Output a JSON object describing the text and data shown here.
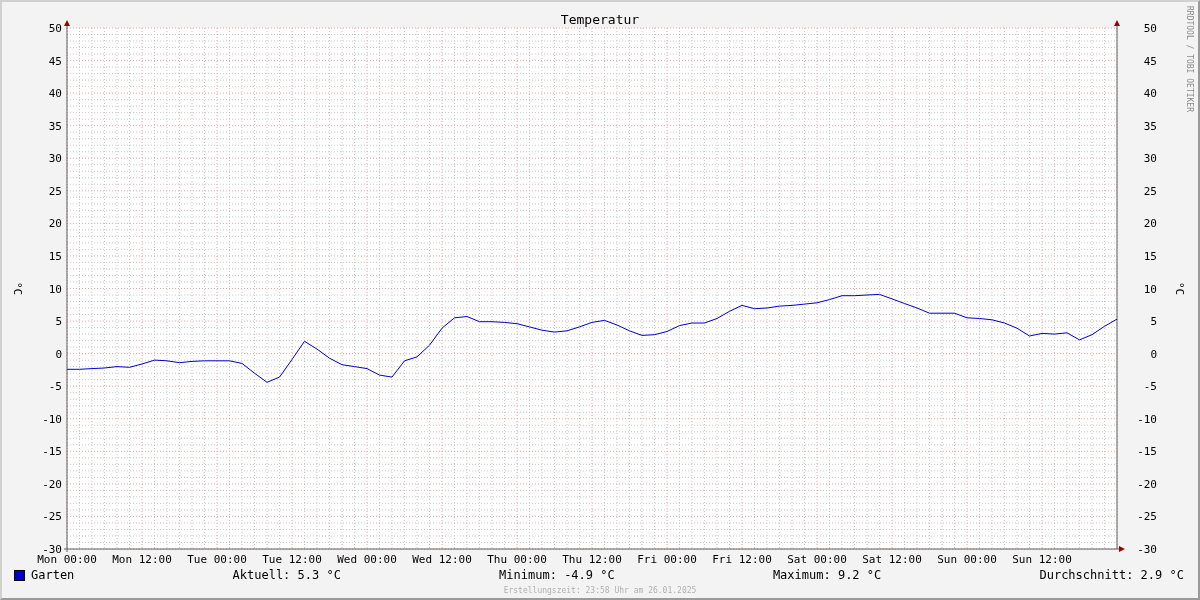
{
  "chart_data": {
    "type": "line",
    "grid": true,
    "title": "Temperatur",
    "ylabel": "°C",
    "ylim": [
      -30,
      50
    ],
    "yticks": [
      50,
      45,
      40,
      35,
      30,
      25,
      20,
      15,
      10,
      5,
      0,
      -5,
      -10,
      -15,
      -20,
      -25,
      -30
    ],
    "categories": [
      "Mon 00:00",
      null,
      null,
      null,
      null,
      null,
      "Mon 12:00",
      null,
      null,
      null,
      null,
      null,
      "Tue 00:00",
      null,
      null,
      null,
      null,
      null,
      "Tue 12:00",
      null,
      null,
      null,
      null,
      null,
      "Wed 00:00",
      null,
      null,
      null,
      null,
      null,
      "Wed 12:00",
      null,
      null,
      null,
      null,
      null,
      "Thu 00:00",
      null,
      null,
      null,
      null,
      null,
      "Thu 12:00",
      null,
      null,
      null,
      null,
      null,
      "Fri 00:00",
      null,
      null,
      null,
      null,
      null,
      "Fri 12:00",
      null,
      null,
      null,
      null,
      null,
      "Sat 00:00",
      null,
      null,
      null,
      null,
      null,
      "Sat 12:00",
      null,
      null,
      null,
      null,
      null,
      "Sun 00:00",
      null,
      null,
      null,
      null,
      null,
      "Sun 12:00",
      null,
      null,
      null,
      null,
      null,
      null
    ],
    "series": [
      {
        "name": "Garten",
        "color": "#0000cc",
        "values": [
          -2.4,
          -2.4,
          -2.3,
          -2.2,
          -2.0,
          -2.1,
          -1.6,
          -1.0,
          -1.1,
          -1.4,
          -1.2,
          -1.1,
          -1.1,
          -1.1,
          -1.5,
          -3.0,
          -4.4,
          -3.6,
          -0.9,
          1.9,
          0.7,
          -0.7,
          -1.7,
          -2.0,
          -2.3,
          -3.3,
          -3.6,
          -1.1,
          -0.5,
          1.3,
          3.9,
          5.5,
          5.7,
          4.9,
          4.9,
          4.8,
          4.6,
          4.1,
          3.6,
          3.3,
          3.5,
          4.1,
          4.8,
          5.1,
          4.4,
          3.5,
          2.8,
          2.9,
          3.4,
          4.3,
          4.7,
          4.7,
          5.4,
          6.5,
          7.4,
          6.9,
          7.0,
          7.3,
          7.4,
          7.6,
          7.8,
          8.3,
          8.9,
          8.9,
          9.0,
          9.1,
          8.4,
          7.7,
          7.0,
          6.2,
          6.2,
          6.2,
          5.5,
          5.4,
          5.2,
          4.7,
          3.9,
          2.7,
          3.1,
          3.0,
          3.2,
          2.1,
          2.9,
          4.2,
          5.3
        ]
      }
    ]
  },
  "right_axis": {
    "label": "°C",
    "ticks": [
      "50",
      "45",
      "40",
      "35",
      "30",
      "25",
      "20",
      "15",
      "10",
      "5",
      "0",
      "-5",
      "-10",
      "-15",
      "-20",
      "-25",
      "-30"
    ]
  },
  "credit": "RRDTOOL / TOBI OETIKER",
  "legend": {
    "stats": [
      "Aktuell: 5.3 °C",
      "Minimum: -4.9 °C",
      "Maximum: 9.2 °C",
      "Durchschnitt: 2.9 °C"
    ]
  },
  "footer": "Erstellungszeit: 23:58 Uhr am 26.01.2025"
}
